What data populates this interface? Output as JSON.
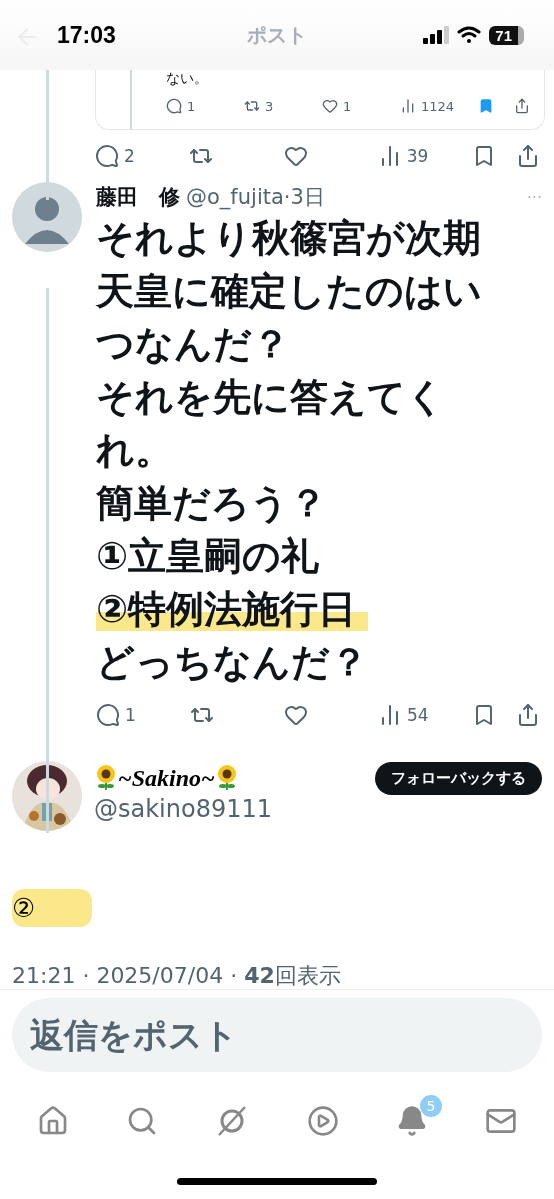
{
  "status_bar": {
    "time": "17:03",
    "battery": "71"
  },
  "header": {
    "title": "ポスト"
  },
  "quoted_card": {
    "text_tail": "ない。",
    "actions": [
      {
        "kind": "reply",
        "count": "1"
      },
      {
        "kind": "repost",
        "count": "3"
      },
      {
        "kind": "like",
        "count": "1"
      },
      {
        "kind": "views",
        "count": "1124"
      },
      {
        "kind": "bookmark",
        "on": true
      },
      {
        "kind": "share"
      }
    ]
  },
  "parent_actions": [
    {
      "kind": "reply",
      "count": "2"
    },
    {
      "kind": "repost"
    },
    {
      "kind": "like"
    },
    {
      "kind": "views",
      "count": "39"
    },
    {
      "kind": "bookmark",
      "on": false
    },
    {
      "kind": "share"
    }
  ],
  "post": {
    "name": "藤田　修",
    "meta": "@o_fujita·3日",
    "more": "···",
    "lines": [
      {
        "text": "それより秋篠宮が次期",
        "highlighted": false
      },
      {
        "text": "天皇に確定したのはい",
        "highlighted": false
      },
      {
        "text": "つなんだ？",
        "highlighted": false
      },
      {
        "text": "それを先に答えてく",
        "highlighted": false
      },
      {
        "text": "れ。",
        "highlighted": false
      },
      {
        "text": "簡単だろう？",
        "highlighted": false
      },
      {
        "text": "①立皇嗣の礼",
        "highlighted": false
      },
      {
        "text": "②特例法施行日",
        "highlighted": true
      },
      {
        "text": "どっちなんだ？",
        "highlighted": false
      }
    ],
    "actions": [
      {
        "kind": "reply",
        "count": "1"
      },
      {
        "kind": "repost"
      },
      {
        "kind": "like"
      },
      {
        "kind": "views",
        "count": "54"
      },
      {
        "kind": "bookmark",
        "on": false
      },
      {
        "kind": "share"
      }
    ]
  },
  "reply": {
    "name": "~Sakino~",
    "handle": "@sakino89111",
    "follow_button": "フォローバックする",
    "text": "②",
    "highlighted": true,
    "timestamp": "21:21 · 2025/07/04 · **42**回表示"
  },
  "reply_bar": {
    "placeholder": "返信をポスト"
  },
  "nav": [
    {
      "kind": "home"
    },
    {
      "kind": "search"
    },
    {
      "kind": "grok"
    },
    {
      "kind": "video"
    },
    {
      "kind": "notifications",
      "badge": "5"
    },
    {
      "kind": "messages"
    }
  ]
}
